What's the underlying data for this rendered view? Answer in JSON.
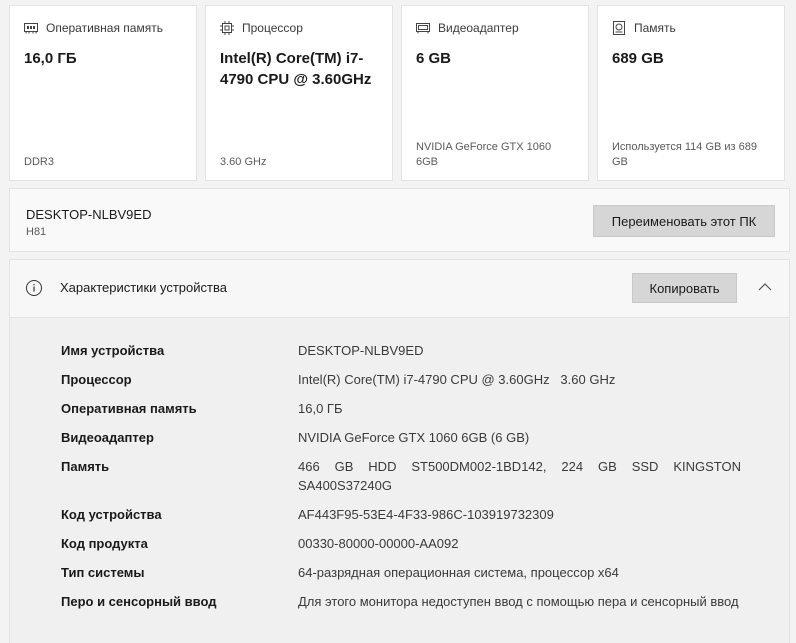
{
  "cards": [
    {
      "icon": "memory-icon",
      "title": "Оперативная память",
      "value": "16,0 ГБ",
      "sub": "DDR3"
    },
    {
      "icon": "cpu-icon",
      "title": "Процессор",
      "value": "Intel(R) Core(TM) i7-4790 CPU @ 3.60GHz",
      "sub": "3.60 GHz"
    },
    {
      "icon": "gpu-icon",
      "title": "Видеоадаптер",
      "value": "6 GB",
      "sub": "NVIDIA GeForce GTX 1060 6GB"
    },
    {
      "icon": "storage-icon",
      "title": "Память",
      "value": "689 GB",
      "sub": "Используется 114 GB из 689 GB"
    }
  ],
  "device": {
    "name": "DESKTOP-NLBV9ED",
    "model": "H81",
    "rename_label": "Переименовать этот ПК"
  },
  "specs": {
    "title": "Характеристики устройства",
    "copy_label": "Копировать",
    "rows": [
      {
        "label": "Имя устройства",
        "value": "DESKTOP-NLBV9ED"
      },
      {
        "label": "Процессор",
        "value": "Intel(R) Core(TM) i7-4790 CPU @ 3.60GHz   3.60 GHz"
      },
      {
        "label": "Оперативная память",
        "value": "16,0 ГБ"
      },
      {
        "label": "Видеоадаптер",
        "value": "NVIDIA GeForce GTX 1060 6GB (6 GB)"
      },
      {
        "label": "Память",
        "value": "466 GB HDD ST500DM002-1BD142, 224 GB SSD KINGSTON SA400S37240G"
      },
      {
        "label": "Код устройства",
        "value": "AF443F95-53E4-4F33-986C-103919732309"
      },
      {
        "label": "Код продукта",
        "value": "00330-80000-00000-AA092"
      },
      {
        "label": "Тип системы",
        "value": "64-разрядная операционная система, процессор x64"
      },
      {
        "label": "Перо и сенсорный ввод",
        "value": "Для этого монитора недоступен ввод с помощью пера и сенсорный ввод"
      }
    ]
  }
}
